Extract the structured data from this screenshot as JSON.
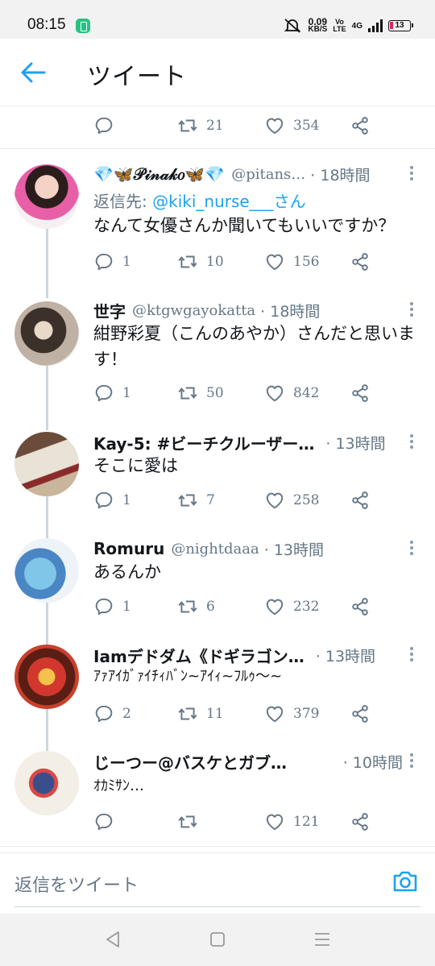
{
  "status_bar": {
    "time": "08:15",
    "speed_value": "0.09",
    "speed_unit": "KB/S",
    "volte_top": "Vo",
    "volte_bottom": "LTE",
    "network": "4G",
    "battery": "13"
  },
  "header": {
    "title": "ツイート"
  },
  "top_tweet": {
    "retweets": "21",
    "likes": "354"
  },
  "tweets": [
    {
      "name": "💎🦋𝒫𝒾𝓃𝒶𝓀𝑜🦋💎",
      "handle": "@pitans…",
      "time": "· 18時間",
      "reply_prefix": "返信先: ",
      "reply_to": "@kiki_nurse___さん",
      "text": "なんて女優さんか聞いてもいいですか？",
      "replies": "1",
      "retweets": "10",
      "likes": "156"
    },
    {
      "name": "世字",
      "handle": "@ktgwgayokatta",
      "time": "· 18時間",
      "text": "紺野彩夏（こんのあやか）さんだと思います！",
      "replies": "1",
      "retweets": "50",
      "likes": "842"
    },
    {
      "name": "Kay-5: #ビーチクルーザー…",
      "handle": "",
      "time": "· 13時間",
      "text": "そこに愛は",
      "replies": "1",
      "retweets": "7",
      "likes": "258"
    },
    {
      "name": "Romuru",
      "handle": "@nightdaaa",
      "time": "· 13時間",
      "text": "あるんか",
      "replies": "1",
      "retweets": "6",
      "likes": "232"
    },
    {
      "name": "Iamデドダム《ドギラゴン…",
      "handle": "",
      "time": "· 13時間",
      "text": "ｱｧｱｲｶﾞｧｲﾁｨﾊﾞﾝ~ｱｲｨ~ﾌﾙｩ〜~",
      "replies": "2",
      "retweets": "11",
      "likes": "379"
    },
    {
      "name": "じーつー@バスケとガブ…",
      "handle": "",
      "time": "· 10時間",
      "text": "ｵｶﾐｻﾝ…",
      "replies": "",
      "retweets": "",
      "likes": "121"
    }
  ],
  "reply_bar": {
    "placeholder": "返信をツイート"
  },
  "colors": {
    "accent": "#1da1f2",
    "secondary_text": "#657786",
    "divider": "#e6ecf0"
  },
  "icons": [
    "back-arrow-icon",
    "reply-icon",
    "retweet-icon",
    "like-icon",
    "share-icon",
    "more-icon",
    "camera-icon",
    "nav-back-icon",
    "nav-home-icon",
    "nav-recents-icon"
  ]
}
